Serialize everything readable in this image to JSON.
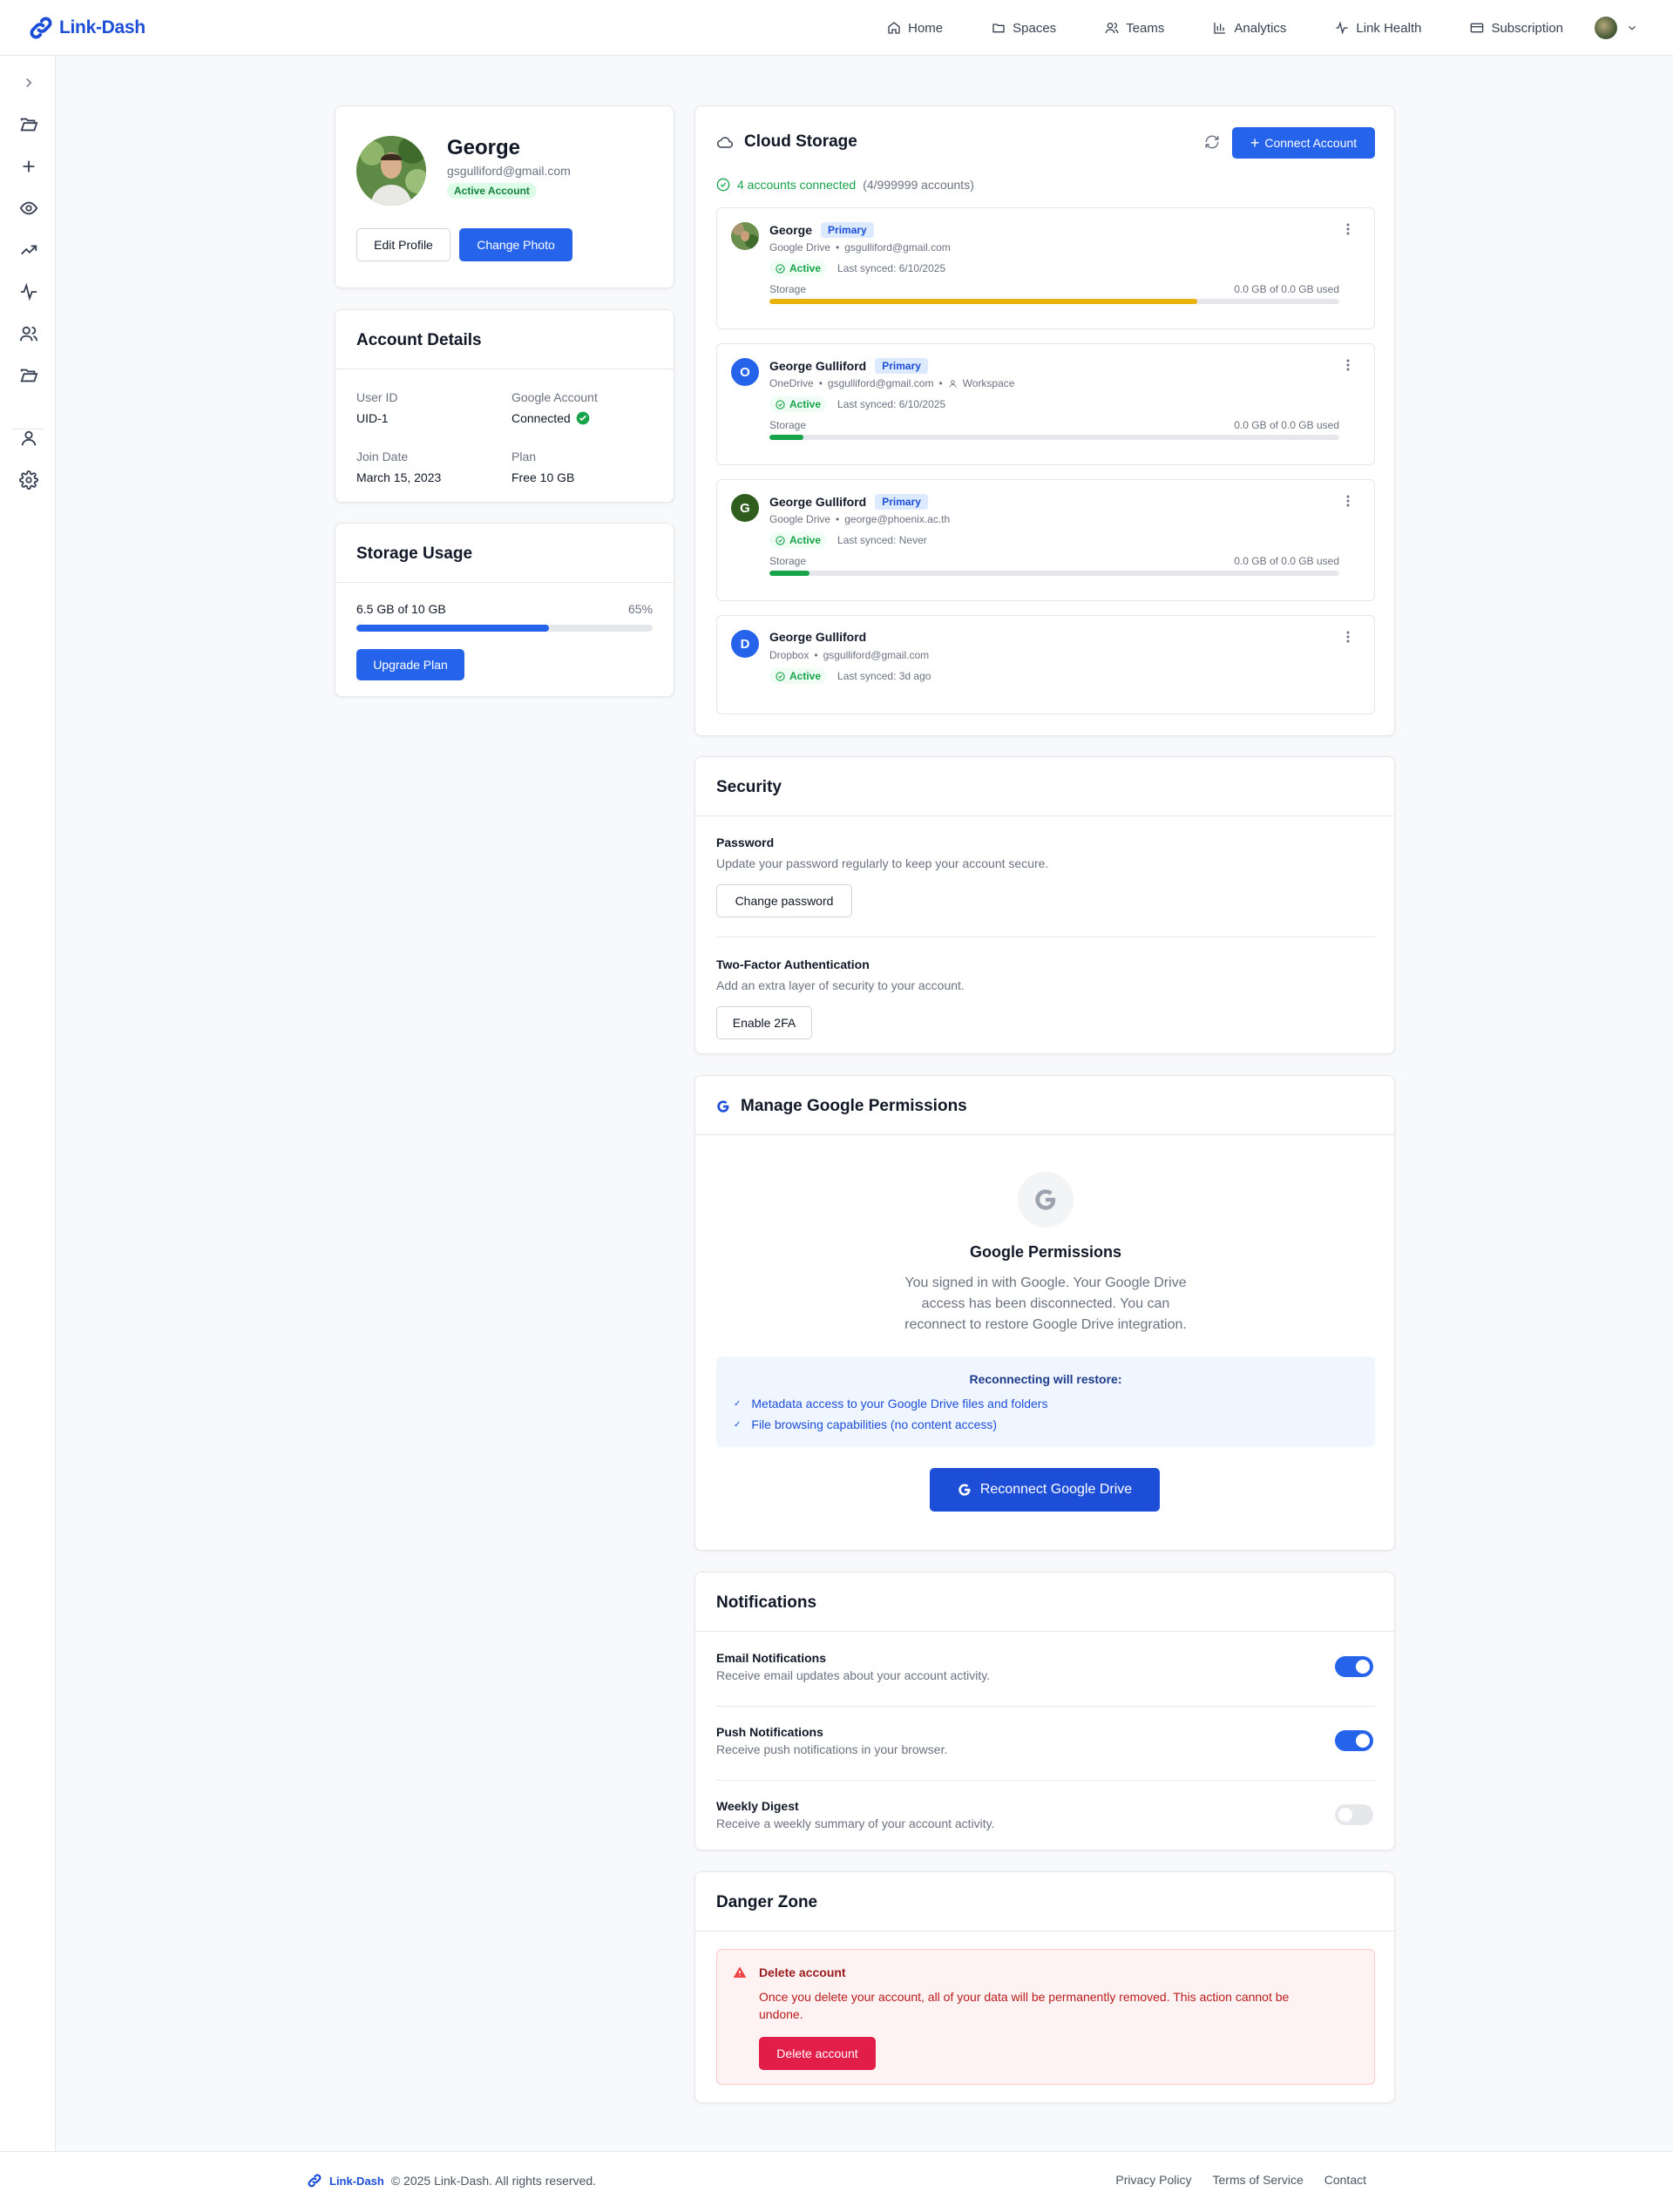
{
  "app": {
    "name": "Link-Dash",
    "brand_color": "#1d4ed8",
    "accent_color": "#2563eb"
  },
  "nav": {
    "links": [
      {
        "label": "Home",
        "icon": "home-icon"
      },
      {
        "label": "Spaces",
        "icon": "folder-icon"
      },
      {
        "label": "Teams",
        "icon": "users-icon"
      },
      {
        "label": "Analytics",
        "icon": "bar-chart-icon"
      },
      {
        "label": "Link Health",
        "icon": "activity-icon"
      },
      {
        "label": "Subscription",
        "icon": "credit-card-icon"
      }
    ]
  },
  "sidebar": {
    "icons": [
      "chevron-right-icon",
      "folder-open-icon",
      "plus-icon",
      "eye-icon",
      "trending-up-icon",
      "activity-icon",
      "users-icon",
      "folder-open-icon",
      "user-icon",
      "settings-icon"
    ]
  },
  "profile": {
    "name": "George",
    "email": "gsgulliford@gmail.com",
    "status": "Active Account",
    "edit_label": "Edit Profile",
    "photo_label": "Change Photo"
  },
  "account_details": {
    "title": "Account Details",
    "user_id_label": "User ID",
    "user_id": "UID-1",
    "google_label": "Google Account",
    "google_value": "Connected",
    "join_label": "Join Date",
    "join_value": "March 15, 2023",
    "plan_label": "Plan",
    "plan_value": "Free 10 GB"
  },
  "storage_usage": {
    "title": "Storage Usage",
    "used_text": "6.5 GB of 10 GB",
    "percent_text": "65%",
    "percent": 65,
    "upgrade_label": "Upgrade Plan"
  },
  "cloud": {
    "title": "Cloud Storage",
    "connect_label": "Connect Account",
    "connected_text": "4 accounts connected",
    "limit_text": "(4/999999 accounts)",
    "accounts": [
      {
        "name": "George",
        "badge": "Primary",
        "provider": "Google Drive",
        "email": "gsgulliford@gmail.com",
        "extra": "",
        "status": "Active",
        "synced": "Last synced: 6/10/2025",
        "storage_label": "Storage",
        "used": "0.0 GB of 0.0 GB used",
        "fill": 0.75,
        "fill_color": "#eab308",
        "avatar": "photo",
        "avatar_color": "#6b8f4e"
      },
      {
        "name": "George Gulliford",
        "badge": "Primary",
        "provider": "OneDrive",
        "email": "gsgulliford@gmail.com",
        "extra": "Workspace",
        "status": "Active",
        "synced": "Last synced: 6/10/2025",
        "storage_label": "Storage",
        "used": "0.0 GB of 0.0 GB used",
        "fill": 0.06,
        "fill_color": "#16a34a",
        "avatar": "O",
        "avatar_color": "#2563eb"
      },
      {
        "name": "George Gulliford",
        "badge": "Primary",
        "provider": "Google Drive",
        "email": "george@phoenix.ac.th",
        "extra": "",
        "status": "Active",
        "synced": "Last synced: Never",
        "storage_label": "Storage",
        "used": "0.0 GB of 0.0 GB used",
        "fill": 0.07,
        "fill_color": "#16a34a",
        "avatar": "G",
        "avatar_color": "#2f5d1e"
      },
      {
        "name": "George Gulliford",
        "badge": "",
        "provider": "Dropbox",
        "email": "gsgulliford@gmail.com",
        "extra": "",
        "status": "Active",
        "synced": "Last synced: 3d ago",
        "storage_label": "",
        "used": "",
        "fill": 0,
        "fill_color": "",
        "avatar": "D",
        "avatar_color": "#2563eb"
      }
    ]
  },
  "security": {
    "title": "Security",
    "password_title": "Password",
    "password_desc": "Update your password regularly to keep your account secure.",
    "password_btn": "Change password",
    "tfa_title": "Two-Factor Authentication",
    "tfa_desc": "Add an extra layer of security to your account.",
    "tfa_btn": "Enable 2FA"
  },
  "google_perms": {
    "title": "Manage Google Permissions",
    "heading": "Google Permissions",
    "desc_1": "You signed in with Google. Your Google Drive",
    "desc_2": "access has been disconnected. You can",
    "desc_3": "reconnect to restore Google Drive integration.",
    "restore_title": "Reconnecting will restore:",
    "restore_items": [
      "Metadata access to your Google Drive files and folders",
      "File browsing capabilities (no content access)"
    ],
    "reconnect_label": "Reconnect Google Drive"
  },
  "notifications": {
    "title": "Notifications",
    "items": [
      {
        "title": "Email Notifications",
        "desc": "Receive email updates about your account activity.",
        "on": true
      },
      {
        "title": "Push Notifications",
        "desc": "Receive push notifications in your browser.",
        "on": true
      },
      {
        "title": "Weekly Digest",
        "desc": "Receive a weekly summary of your account activity.",
        "on": false
      }
    ]
  },
  "danger": {
    "title": "Danger Zone",
    "alert_title": "Delete account",
    "alert_desc_1": "Once you delete your account, all of your data will be permanently removed. This action cannot be",
    "alert_desc_2": "undone.",
    "delete_label": "Delete account"
  },
  "footer": {
    "brand": "Link-Dash",
    "copyright": "© 2025 Link-Dash. All rights reserved.",
    "links": [
      "Privacy Policy",
      "Terms of Service",
      "Contact"
    ]
  }
}
